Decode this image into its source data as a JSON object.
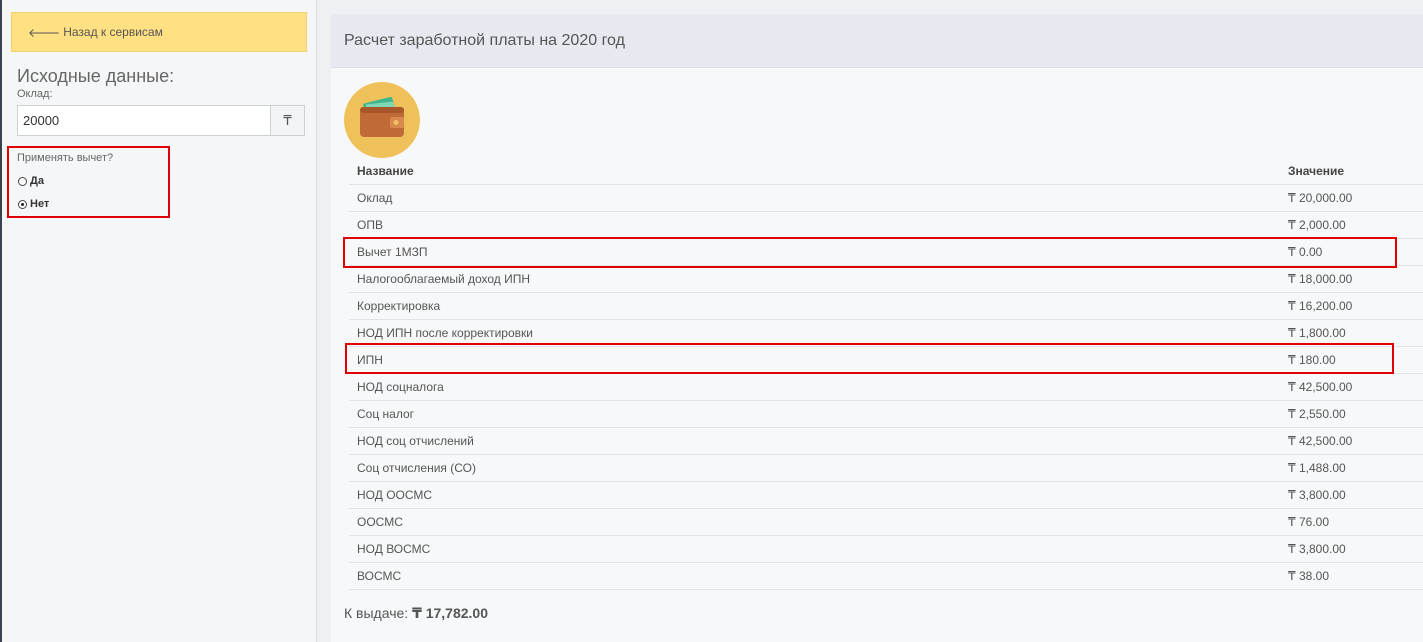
{
  "sidebar": {
    "back_label": "Назад к сервисам",
    "title": "Исходные данные:",
    "salary_label": "Оклад:",
    "salary_value": "20000",
    "currency_symbol": "₸",
    "deduction_label": "Применять вычет?",
    "deduction_options": [
      {
        "label": "Да",
        "checked": false
      },
      {
        "label": "Нет",
        "checked": true
      }
    ]
  },
  "main": {
    "title": "Расчет заработной платы на 2020 год",
    "icon": "wallet-icon",
    "table": {
      "headers": [
        "Название",
        "Значение"
      ],
      "rows": [
        {
          "name": "Оклад",
          "value": "₸ 20,000.00"
        },
        {
          "name": "ОПВ",
          "value": "₸ 2,000.00"
        },
        {
          "name": "Вычет 1МЗП",
          "value": "₸ 0.00"
        },
        {
          "name": "Налогооблагаемый доход ИПН",
          "value": "₸ 18,000.00"
        },
        {
          "name": "Корректировка",
          "value": "₸ 16,200.00"
        },
        {
          "name": "НОД ИПН после корректировки",
          "value": "₸ 1,800.00"
        },
        {
          "name": "ИПН",
          "value": "₸ 180.00"
        },
        {
          "name": "НОД соцналога",
          "value": "₸ 42,500.00"
        },
        {
          "name": "Соц налог",
          "value": "₸ 2,550.00"
        },
        {
          "name": "НОД соц отчислений",
          "value": "₸ 42,500.00"
        },
        {
          "name": "Соц отчисления (СО)",
          "value": "₸ 1,488.00"
        },
        {
          "name": "НОД ООСМС",
          "value": "₸ 3,800.00"
        },
        {
          "name": "ООСМС",
          "value": "₸ 76.00"
        },
        {
          "name": "НОД ВОСМС",
          "value": "₸ 3,800.00"
        },
        {
          "name": "ВОСМС",
          "value": "₸ 38.00"
        }
      ]
    },
    "payout_label": "К выдаче:",
    "payout_value": "₸ 17,782.00"
  },
  "colors": {
    "back_button_bg": "#ffe082",
    "highlight_border": "#e00000",
    "header_bg": "#e6e9f0",
    "wallet_circle": "#efc15a"
  }
}
